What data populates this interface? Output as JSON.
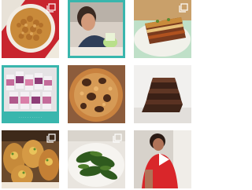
{
  "feed": {
    "tiles": [
      {
        "subject": "roasted chickpeas in bowl",
        "type": "image",
        "badge": "carousel-icon"
      },
      {
        "subject": "woman with smoothie",
        "type": "image",
        "badge": ""
      },
      {
        "subject": "layered casserole slice",
        "type": "image",
        "badge": "carousel-icon"
      },
      {
        "subject": "pill bottles on teal",
        "type": "image",
        "badge": "",
        "caption": "· · · · · · · · · · ·"
      },
      {
        "subject": "chocolate chip cookie",
        "type": "image",
        "badge": ""
      },
      {
        "subject": "stacked brownies",
        "type": "image",
        "badge": ""
      },
      {
        "subject": "stuffed potatoes",
        "type": "image",
        "badge": "carousel-icon"
      },
      {
        "subject": "spinach greens on plate",
        "type": "image",
        "badge": "carousel-icon"
      },
      {
        "subject": "woman in red shirt",
        "type": "video",
        "badge": "play-icon"
      }
    ]
  },
  "colors": {
    "accent_teal": "#39b6ad",
    "overlay_white": "#ffffff"
  }
}
